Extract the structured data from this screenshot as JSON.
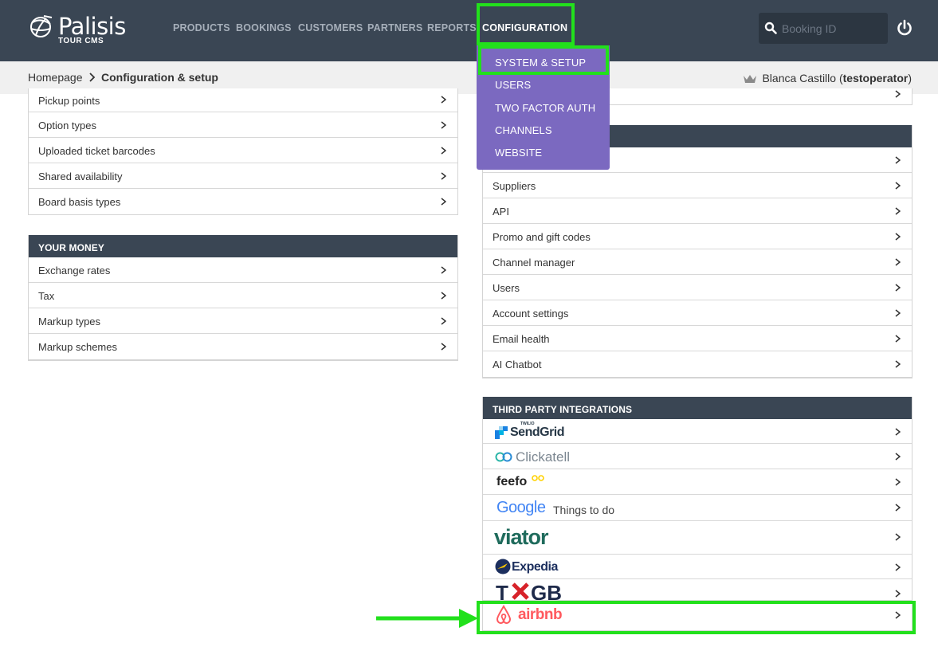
{
  "app": {
    "brand": "Palisis",
    "sub": "TOUR CMS"
  },
  "nav": {
    "products": "PRODUCTS",
    "bookings": "BOOKINGS",
    "customers": "CUSTOMERS",
    "partners": "PARTNERS",
    "reports": "REPORTS",
    "configuration": "CONFIGURATION"
  },
  "search": {
    "placeholder": "Booking ID"
  },
  "breadcrumb": {
    "home": "Homepage",
    "current": "Configuration & setup"
  },
  "user": {
    "name": "Blanca Castillo",
    "login": "testoperator"
  },
  "dropdown": {
    "items": [
      "SYSTEM & SETUP",
      "USERS",
      "TWO FACTOR AUTH",
      "CHANNELS",
      "WEBSITE"
    ]
  },
  "left_top_panel": {
    "items": [
      "Pickup points",
      "Option types",
      "Uploaded ticket barcodes",
      "Shared availability",
      "Board basis types"
    ]
  },
  "money_panel": {
    "title": "YOUR MONEY",
    "items": [
      "Exchange rates",
      "Tax",
      "Markup types",
      "Markup schemes"
    ]
  },
  "right_system_panel": {
    "items": [
      "Suppliers",
      "API",
      "Promo and gift codes",
      "Channel manager",
      "Users",
      "Account settings",
      "Email health",
      "AI Chatbot"
    ]
  },
  "integrations_panel": {
    "title": "THIRD PARTY INTEGRATIONS",
    "sendgrid": {
      "pre": "TWILIO",
      "name": "SendGrid"
    },
    "clickatell": "Clickatell",
    "feefo": "feefo",
    "google": {
      "name": "Google",
      "suffix": "Things to do"
    },
    "viator": "viator",
    "expedia": "Expedia",
    "tgb": {
      "a": "T",
      "b": "GB"
    },
    "airbnb": "airbnb"
  },
  "colors": {
    "topbar": "#3a4654",
    "dropdown": "#7b69c0",
    "highlight": "#22e01c",
    "airbnb": "#ff5a5f"
  }
}
